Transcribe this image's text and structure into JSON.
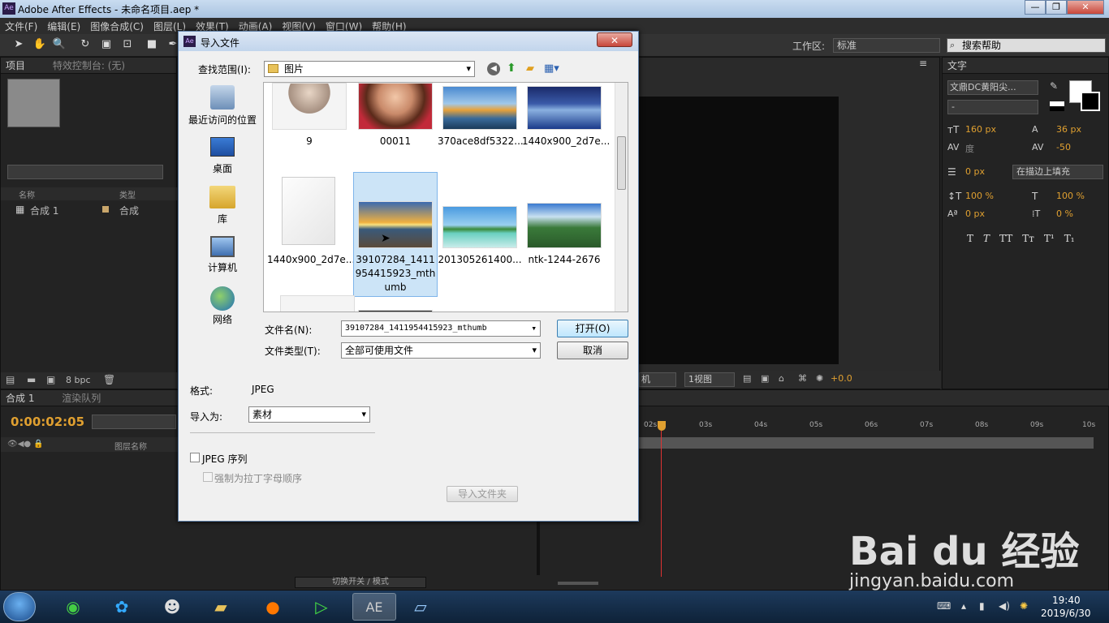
{
  "window": {
    "title": "Adobe After Effects - 未命名项目.aep *",
    "app_icon": "Ae",
    "controls": [
      "—",
      "❐",
      "✕"
    ]
  },
  "menubar": [
    "文件(F)",
    "编辑(E)",
    "图像合成(C)",
    "图层(L)",
    "效果(T)",
    "动画(A)",
    "视图(V)",
    "窗口(W)",
    "帮助(H)"
  ],
  "toolbar": {
    "workspace_label": "工作区:",
    "workspace_value": "标准",
    "search_help": "搜索帮助"
  },
  "project_panel": {
    "tab": "项目",
    "tab_menu": "≡",
    "effects_tab": "特效控制台: (无)",
    "col_name": "名称",
    "col_type": "类型",
    "items": [
      {
        "name": "合成 1",
        "type": "合成"
      }
    ],
    "bpc": "8 bpc"
  },
  "character_panel": {
    "tab": "文字",
    "font": "文鼎DC黄阳尖...",
    "style": "-",
    "size": "160 px",
    "leading": "36 px",
    "kerning": "度",
    "tracking": "-50",
    "stroke": "0 px",
    "stroke_mode": "在描边上填充",
    "vscale": "100 %",
    "hscale": "100 %",
    "baseline": "0 px",
    "tsume": "0 %",
    "styles": [
      "T",
      "T",
      "TT",
      "Tт",
      "T¹",
      "T₁"
    ]
  },
  "viewer": {
    "camera": "机",
    "views": "1视图",
    "exposure": "+0.0"
  },
  "timeline": {
    "tab_comp": "合成 1",
    "tab_render": "渲染队列",
    "timecode": "0:00:02:05",
    "layer_name_col": "图层名称",
    "ticks": [
      "02s",
      "03s",
      "04s",
      "05s",
      "06s",
      "07s",
      "08s",
      "09s",
      "10s"
    ],
    "toggle_label": "切换开关 / 模式"
  },
  "dialog": {
    "title": "导入文件",
    "icon": "Ae",
    "look_in_label": "查找范围(I):",
    "look_in_value": "图片",
    "places": [
      {
        "label": "最近访问的位置"
      },
      {
        "label": "桌面"
      },
      {
        "label": "库"
      },
      {
        "label": "计算机"
      },
      {
        "label": "网络"
      }
    ],
    "files": [
      {
        "name": "9"
      },
      {
        "name": "00011"
      },
      {
        "name": "370ace8df5322..."
      },
      {
        "name": "1440x900_2d7e..."
      },
      {
        "name": "1440x900_2d7e..."
      },
      {
        "name": "39107284_1411954415923_mthumb",
        "selected": true
      },
      {
        "name": "201305261400..."
      },
      {
        "name": "ntk-1244-2676"
      }
    ],
    "filename_label": "文件名(N):",
    "filename_value": "39107284_1411954415923_mthumb",
    "filetype_label": "文件类型(T):",
    "filetype_value": "全部可使用文件",
    "open_button": "打开(O)",
    "cancel_button": "取消",
    "format_label": "格式:",
    "format_value": "JPEG",
    "import_as_label": "导入为:",
    "import_as_value": "素材",
    "sequence_label": "JPEG 序列",
    "alpha_label": "强制为拉丁字母顺序",
    "import_folder_button": "导入文件夹"
  },
  "taskbar": {
    "time": "19:40",
    "date": "2019/6/30"
  },
  "watermark": {
    "brand": "Bai du 经验",
    "url": "jingyan.baidu.com"
  }
}
